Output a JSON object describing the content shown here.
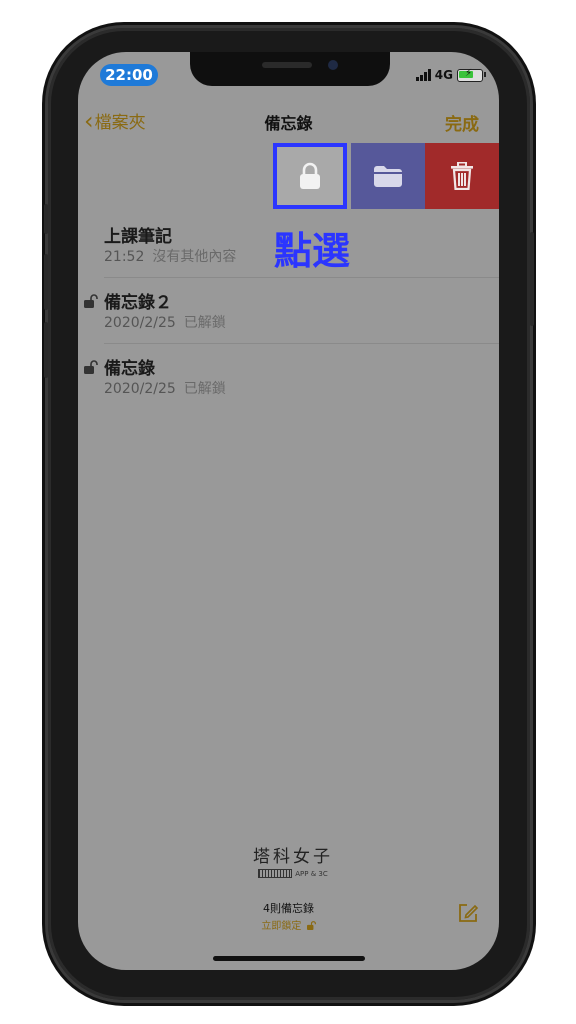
{
  "status": {
    "time": "22:00",
    "network": "4G"
  },
  "nav": {
    "back_chevron": "‹",
    "back_label": "檔案夾",
    "title": "備忘錄",
    "done_label": "完成"
  },
  "swipe_actions": {
    "lock_icon": "lock-icon",
    "folder_icon": "folder-icon",
    "trash_icon": "trash-icon",
    "colors": {
      "folder_bg": "#56589a",
      "trash_bg": "#a12a2a",
      "highlight": "#2b35ff"
    }
  },
  "annotation": "點選",
  "notes": [
    {
      "title": "上課筆記",
      "date": "21:52",
      "preview": "沒有其他內容"
    },
    {
      "title": "備忘錄２",
      "date": "2020/2/25",
      "preview": "已解鎖"
    },
    {
      "title": "備忘錄",
      "date": "2020/2/25",
      "preview": "已解鎖"
    }
  ],
  "watermark": {
    "title": "塔科女子",
    "subtitle": "APP & 3C"
  },
  "footer": {
    "count": "4則備忘錄",
    "lock_now": "立即鎖定"
  }
}
